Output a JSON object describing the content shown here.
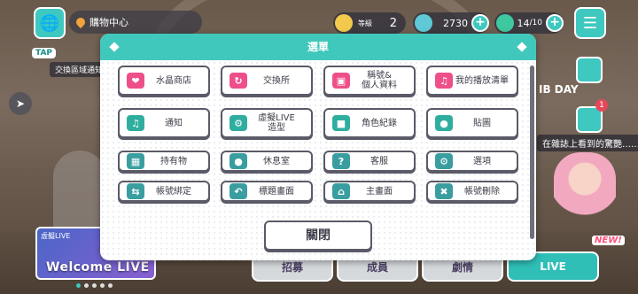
{
  "top_bar": {
    "location": "購物中心",
    "rank_label": "等級",
    "rank_value": "2",
    "crystals": "2730",
    "stamina": "14",
    "stamina_max": "/10"
  },
  "scene": {
    "tap_label": "TAP",
    "side_label": "交換區域通知",
    "day_label": "IB DAY",
    "news_text": "在雜誌上看到的驚艷……",
    "news_badge": "1",
    "new_tag": "NEW!",
    "banner_tag": "虛擬LIVE",
    "banner_title": "Welcome LIVE",
    "bottom_nav": [
      "招募",
      "成員",
      "劇情",
      "LIVE"
    ]
  },
  "modal": {
    "title": "選單",
    "close_label": "關閉",
    "items": [
      {
        "label": "水晶商店",
        "icon": "crystal-icon"
      },
      {
        "label": "交換所",
        "icon": "exchange-icon"
      },
      {
        "label": "稱號&\n個人資料",
        "icon": "profile-card-icon"
      },
      {
        "label": "我的播放清單",
        "icon": "playlist-icon"
      },
      {
        "label": "通知",
        "icon": "bell-icon"
      },
      {
        "label": "虛擬LIVE\n造型",
        "icon": "costume-icon"
      },
      {
        "label": "角色紀錄",
        "icon": "character-record-icon"
      },
      {
        "label": "貼圖",
        "icon": "sticker-icon"
      },
      {
        "label": "持有物",
        "icon": "items-icon"
      },
      {
        "label": "休息室",
        "icon": "lounge-icon"
      },
      {
        "label": "客服",
        "icon": "help-icon"
      },
      {
        "label": "選項",
        "icon": "gear-icon"
      },
      {
        "label": "帳號綁定",
        "icon": "link-account-icon"
      },
      {
        "label": "標題畫面",
        "icon": "back-arrow-icon"
      },
      {
        "label": "主畫面",
        "icon": "home-icon"
      },
      {
        "label": "帳號刪除",
        "icon": "delete-account-icon"
      }
    ]
  },
  "colors": {
    "accent": "#41c8bc",
    "crystal_icon": "#ee4f8a",
    "notify_icon": "#2fae9f",
    "item_icon": "#3a9ea0"
  }
}
